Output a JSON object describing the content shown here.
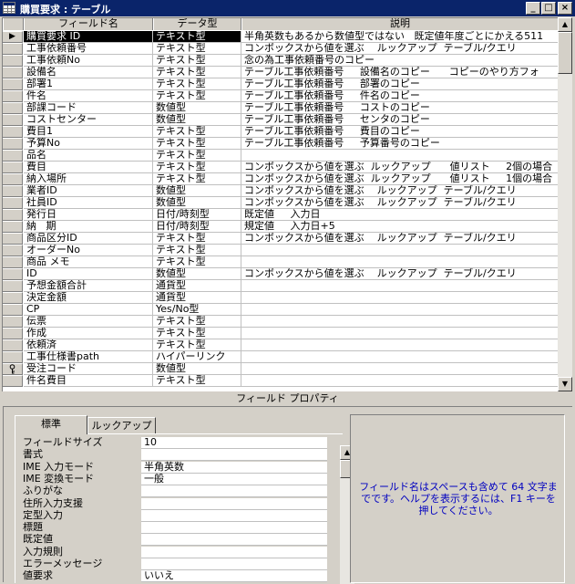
{
  "window": {
    "title": "購買要求 : テーブル",
    "minimize": "_",
    "maximize": "□",
    "close": "×"
  },
  "columns": {
    "name": "フィールド名",
    "type": "データ型",
    "desc": "説明"
  },
  "current_row_marker": "▶",
  "key_icon": "key-icon",
  "fields": [
    {
      "name": "購買要求 ID",
      "type": "テキスト型",
      "desc": "半角英数もあるから数値型ではない   既定値年度ごとにかえる511"
    },
    {
      "name": "工事依頼番号",
      "type": "テキスト型",
      "desc": "コンボックスから値を選ぶ    ルックアップ  テーブル/クエリ"
    },
    {
      "name": "工事依頼No",
      "type": "テキスト型",
      "desc": "念の為工事依頼番号のコピー"
    },
    {
      "name": "設備名",
      "type": "テキスト型",
      "desc": "テーブル工事依頼番号     設備名のコピー      コピーのやり方フォ"
    },
    {
      "name": "部署1",
      "type": "テキスト型",
      "desc": "テーブル工事依頼番号     部署のコピー"
    },
    {
      "name": "件名",
      "type": "テキスト型",
      "desc": "テーブル工事依頼番号     件名のコピー"
    },
    {
      "name": "部課コード",
      "type": "数値型",
      "desc": "テーブル工事依頼番号     コストのコピー"
    },
    {
      "name": "コストセンター",
      "type": "数値型",
      "desc": "テーブル工事依頼番号     センタのコピー"
    },
    {
      "name": "費目1",
      "type": "テキスト型",
      "desc": "テーブル工事依頼番号     費目のコピー"
    },
    {
      "name": "予算No",
      "type": "テキスト型",
      "desc": "テーブル工事依頼番号     予算番号のコピー"
    },
    {
      "name": "品名",
      "type": "テキスト型",
      "desc": ""
    },
    {
      "name": "費目",
      "type": "テキスト型",
      "desc": "コンボックスから値を選ぶ  ルックアップ      値リスト     2個の場合"
    },
    {
      "name": "納入場所",
      "type": "テキスト型",
      "desc": "コンボックスから値を選ぶ  ルックアップ      値リスト     1個の場合"
    },
    {
      "name": "業者ID",
      "type": "数値型",
      "desc": "コンボックスから値を選ぶ    ルックアップ  テーブル/クエリ"
    },
    {
      "name": "社員ID",
      "type": "数値型",
      "desc": "コンボックスから値を選ぶ    ルックアップ  テーブル/クエリ"
    },
    {
      "name": "発行日",
      "type": "日付/時刻型",
      "desc": "既定値     入力日"
    },
    {
      "name": "納   期",
      "type": "日付/時刻型",
      "desc": "規定値     入力日+5"
    },
    {
      "name": "商品区分ID",
      "type": "テキスト型",
      "desc": "コンボックスから値を選ぶ    ルックアップ  テーブル/クエリ"
    },
    {
      "name": "オーダーNo",
      "type": "テキスト型",
      "desc": ""
    },
    {
      "name": "商品 メモ",
      "type": "テキスト型",
      "desc": ""
    },
    {
      "name": "ID",
      "type": "数値型",
      "desc": "コンボックスから値を選ぶ    ルックアップ  テーブル/クエリ"
    },
    {
      "name": "予想金額合計",
      "type": "通貨型",
      "desc": ""
    },
    {
      "name": "決定金額",
      "type": "通貨型",
      "desc": ""
    },
    {
      "name": "CP",
      "type": "Yes/No型",
      "desc": ""
    },
    {
      "name": "伝票",
      "type": "テキスト型",
      "desc": ""
    },
    {
      "name": "作成",
      "type": "テキスト型",
      "desc": ""
    },
    {
      "name": "依頼済",
      "type": "テキスト型",
      "desc": ""
    },
    {
      "name": "工事仕様書path",
      "type": "ハイパーリンク",
      "desc": ""
    },
    {
      "name": "受注コード",
      "type": "数値型",
      "desc": "",
      "key": true
    },
    {
      "name": "件名費目",
      "type": "テキスト型",
      "desc": ""
    }
  ],
  "property_panel": {
    "title": "フィールド プロパティ",
    "tabs": [
      "標準",
      "ルックアップ"
    ],
    "active_tab": "標準",
    "properties": [
      {
        "label": "フィールドサイズ",
        "value": "10"
      },
      {
        "label": "書式",
        "value": ""
      },
      {
        "label": "IME 入力モード",
        "value": "半角英数"
      },
      {
        "label": "IME 変換モード",
        "value": "一般"
      },
      {
        "label": "ふりがな",
        "value": ""
      },
      {
        "label": "住所入力支援",
        "value": ""
      },
      {
        "label": "定型入力",
        "value": ""
      },
      {
        "label": "標題",
        "value": ""
      },
      {
        "label": "既定値",
        "value": ""
      },
      {
        "label": "入力規則",
        "value": ""
      },
      {
        "label": "エラーメッセージ",
        "value": ""
      },
      {
        "label": "値要求",
        "value": "いいえ"
      }
    ],
    "help_text": "フィールド名はスペースも含めて 64 文字までです。ヘルプを表示するには、F1 キーを押してください。"
  }
}
